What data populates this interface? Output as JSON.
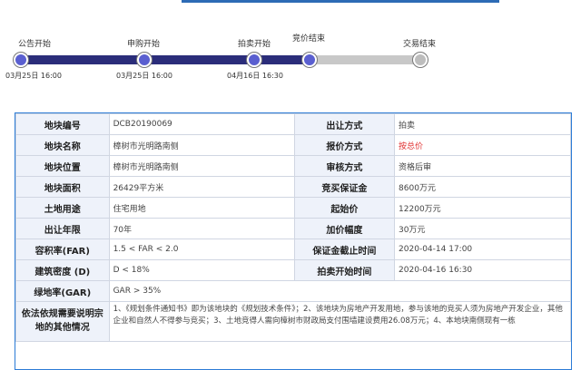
{
  "timeline": {
    "steps": [
      {
        "label": "公告开始",
        "time": "03月25日 16:00",
        "state": "done"
      },
      {
        "label": "申购开始",
        "time": "03月25日 16:00",
        "state": "done"
      },
      {
        "label": "拍卖开始",
        "time": "04月16日 16:30",
        "state": "done"
      },
      {
        "label": "竞价结束",
        "time": "",
        "state": "done"
      },
      {
        "label": "交易结束",
        "time": "",
        "state": "todo"
      }
    ]
  },
  "details": {
    "rows": [
      {
        "k1": "地块编号",
        "v1": "DCB20190069",
        "k2": "出让方式",
        "v2": "拍卖"
      },
      {
        "k1": "地块名称",
        "v1": "樟树市光明路南侧",
        "k2": "报价方式",
        "v2": "按总价"
      },
      {
        "k1": "地块位置",
        "v1": "樟树市光明路南侧",
        "k2": "审核方式",
        "v2": "资格后审"
      },
      {
        "k1": "地块面积",
        "v1": "26429平方米",
        "k2": "竞买保证金",
        "v2": "8600万元"
      },
      {
        "k1": "土地用途",
        "v1": "住宅用地",
        "k2": "起始价",
        "v2": "12200万元"
      },
      {
        "k1": "出让年限",
        "v1": "70年",
        "k2": "加价幅度",
        "v2": "30万元"
      },
      {
        "k1": "容积率(FAR)",
        "v1": "1.5 < FAR < 2.0",
        "k2": "保证金截止时间",
        "v2": "2020-04-14 17:00"
      },
      {
        "k1": "建筑密度 (D)",
        "v1": "D < 18%",
        "k2": "拍卖开始时间",
        "v2": "2020-04-16 16:30"
      },
      {
        "k1": "绿地率(GAR)",
        "v1": "GAR > 35%"
      }
    ],
    "notes_key": "依法依规需要说明宗地的其他情况",
    "notes_value": "1、《规划条件通知书》即为该地块的《规划技术条件》；2、该地块为房地产开发用地，参与该地的竞买人须为房地产开发企业，其他企业和自然人不得参与竞买；3、土地竞得人需向樟树市财政局支付围墙建设费用26.08万元；4、本地块南侧现有一栋"
  },
  "colors": {
    "progress_done": "#2b2d7a",
    "progress_todo": "#c8c8c8",
    "highlight_red": "#e03030",
    "table_border": "#2b7bd6"
  }
}
